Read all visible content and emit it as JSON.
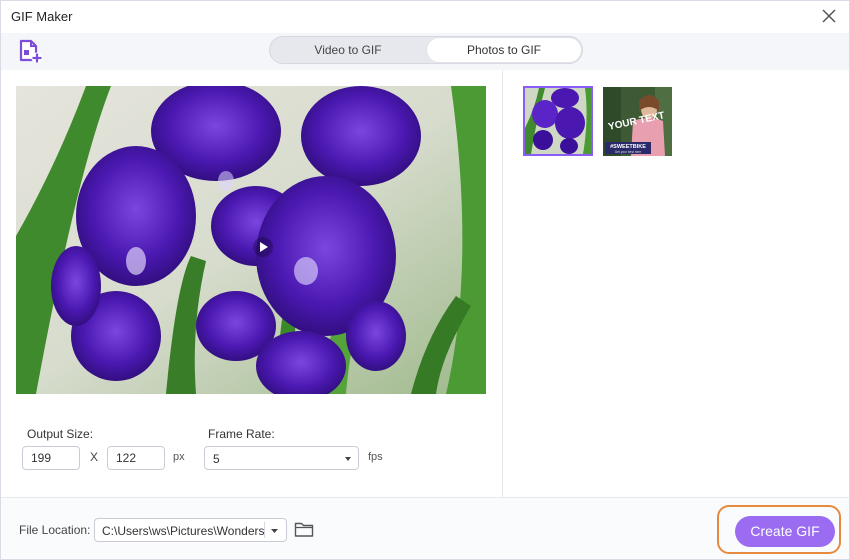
{
  "window": {
    "title": "GIF Maker"
  },
  "icons": {
    "close": "close-icon",
    "add_file": "add-file-icon",
    "play": "play-icon",
    "select_caret": "chevron-down-icon",
    "folder": "folder-icon"
  },
  "tabs": [
    {
      "label": "Video to GIF",
      "active": false
    },
    {
      "label": "Photos to GIF",
      "active": true
    }
  ],
  "settings": {
    "output_size_label": "Output Size:",
    "width": "199",
    "separator": "X",
    "height": "122",
    "size_unit": "px",
    "frame_rate_label": "Frame Rate:",
    "frame_rate_value": "5",
    "frame_rate_unit": "fps"
  },
  "thumbnails": [
    {
      "name": "iris-flowers-photo",
      "selected": true
    },
    {
      "name": "girl-photo-with-text",
      "selected": false,
      "overlay_text": "YOUR TEXT",
      "banner_text": "#SWEETBIKE",
      "banner_subtext": "Get your best here"
    }
  ],
  "footer": {
    "file_location_label": "File Location:",
    "path": "C:\\Users\\ws\\Pictures\\Wondershare",
    "create_label": "Create GIF"
  },
  "colors": {
    "accent": "#9b6cf2",
    "highlight_ring": "#e58a3e",
    "selected_border": "#8b5cf6",
    "toolbar_bg": "#f5f6fa"
  }
}
